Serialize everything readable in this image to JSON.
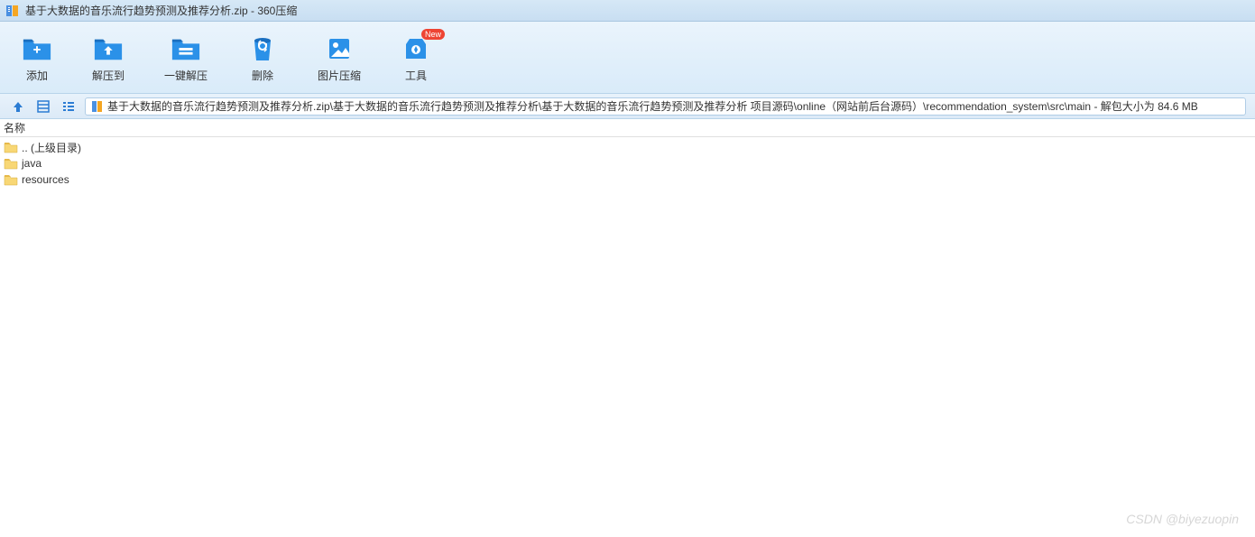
{
  "titlebar": {
    "title": "基于大数据的音乐流行趋势预测及推荐分析.zip - 360压缩"
  },
  "toolbar": {
    "add": "添加",
    "extract_to": "解压到",
    "one_click_extract": "一键解压",
    "delete": "删除",
    "image_compress": "图片压缩",
    "tools": "工具",
    "new_badge": "New"
  },
  "pathbar": {
    "path": "基于大数据的音乐流行趋势预测及推荐分析.zip\\基于大数据的音乐流行趋势预测及推荐分析\\基于大数据的音乐流行趋势预测及推荐分析 项目源码\\online（网站前后台源码）\\recommendation_system\\src\\main - 解包大小为 84.6 MB"
  },
  "columns": {
    "name": "名称"
  },
  "files": {
    "parent": ".. (上级目录)",
    "java": "java",
    "resources": "resources"
  },
  "watermark": "CSDN @biyezuopin"
}
